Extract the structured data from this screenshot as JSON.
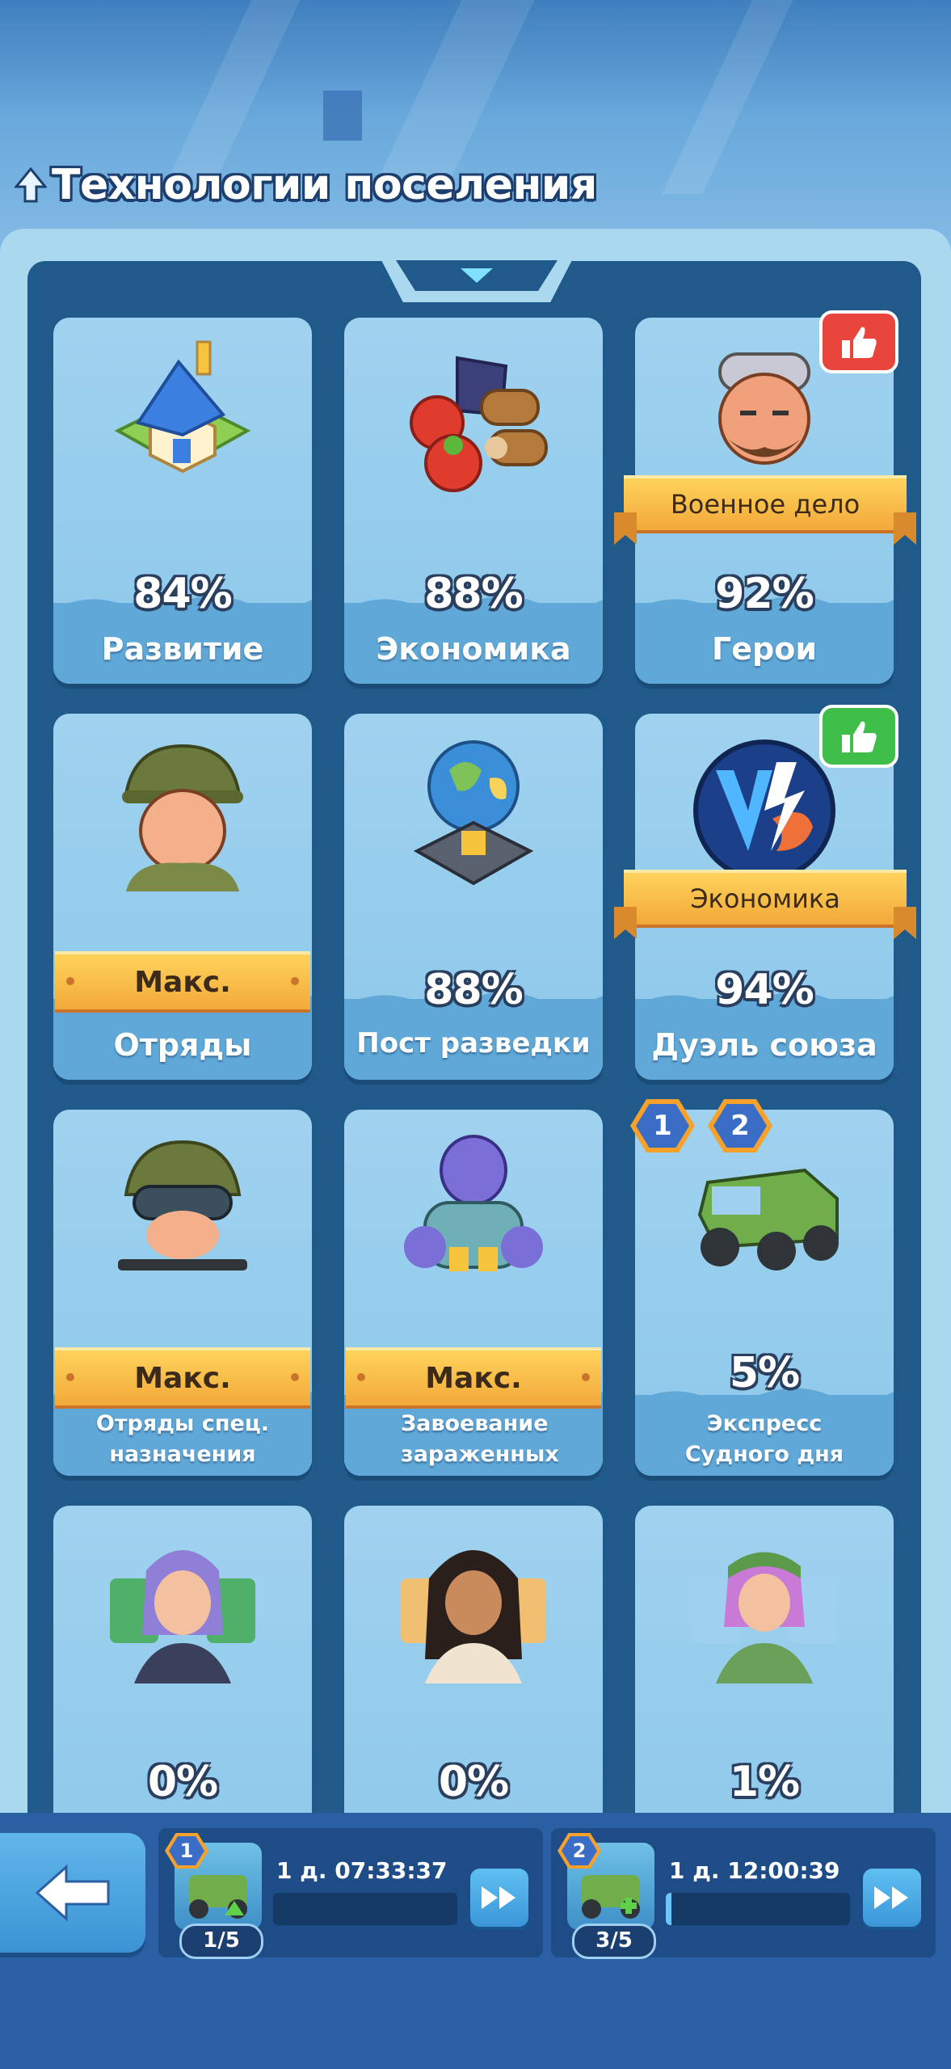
{
  "header": {
    "title": "Технологии поселения"
  },
  "cards": [
    {
      "label": "Развитие",
      "percent": "84%"
    },
    {
      "label": "Экономика",
      "percent": "88%"
    },
    {
      "label": "Герои",
      "percent": "92%",
      "ribbon": "Военное дело",
      "badge": "thumbs-up-red"
    },
    {
      "label": "Отряды",
      "ribbon": "Макс."
    },
    {
      "label": "Пост разведки",
      "percent": "88%"
    },
    {
      "label": "Дуэль союза",
      "percent": "94%",
      "ribbon": "Экономика",
      "badge": "thumbs-up-green"
    },
    {
      "label": "Отряды спец. назначения",
      "ribbon": "Макс."
    },
    {
      "label": "Завоевание зараженных",
      "ribbon": "Макс."
    },
    {
      "label": "Экспресс Судного дня",
      "percent": "5%",
      "slots": [
        "1",
        "2"
      ]
    },
    {
      "percent": "0%"
    },
    {
      "percent": "0%"
    },
    {
      "percent": "1%"
    }
  ],
  "queues": [
    {
      "slot": "1",
      "timer": "1 д. 07:33:37",
      "count": "1/5",
      "progress": 0.0
    },
    {
      "slot": "2",
      "timer": "1 д. 12:00:39",
      "count": "3/5",
      "progress": 0.03
    }
  ],
  "colors": {
    "accent_red": "#e8453c",
    "accent_green": "#3fbf4a",
    "ribbon_gold": "#f2a93a",
    "panel_dark": "#1f5a8a"
  },
  "icons": {
    "back": "back-arrow-icon",
    "speed": "fast-forward-icon",
    "collapse": "chevron-down-icon",
    "title": "arrow-up-icon"
  }
}
